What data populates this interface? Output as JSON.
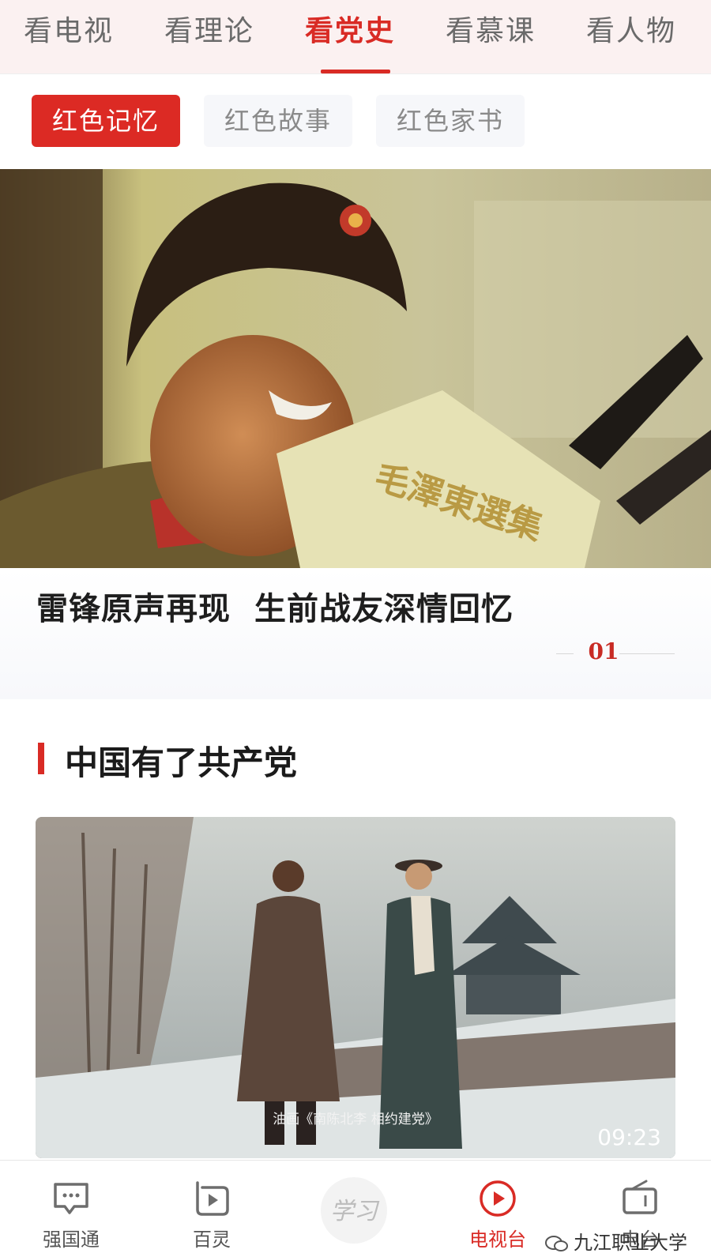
{
  "top_tabs": [
    {
      "label": "看电视",
      "active": false
    },
    {
      "label": "看理论",
      "active": false
    },
    {
      "label": "看党史",
      "active": true
    },
    {
      "label": "看慕课",
      "active": false
    },
    {
      "label": "看人物",
      "active": false
    }
  ],
  "sub_tabs": [
    {
      "label": "红色记忆",
      "active": true
    },
    {
      "label": "红色故事",
      "active": false
    },
    {
      "label": "红色家书",
      "active": false
    }
  ],
  "hero": {
    "title_part1": "雷锋原声再现",
    "title_part2": "生前战友深情回忆",
    "book_text": "毛澤東選集",
    "index": "01"
  },
  "section": {
    "title": "中国有了共产党"
  },
  "video": {
    "caption": "油画《南陈北李  相约建党》",
    "duration": "09:23"
  },
  "bottom_nav": [
    {
      "label": "强国通",
      "icon": "chat-bubble-icon",
      "active": false
    },
    {
      "label": "百灵",
      "icon": "play-tag-icon",
      "active": false
    },
    {
      "label": "学习",
      "icon": "xuexi-logo-icon",
      "active": false
    },
    {
      "label": "电视台",
      "icon": "play-circle-icon",
      "active": true
    },
    {
      "label": "电台",
      "icon": "radio-icon",
      "active": false
    }
  ],
  "watermark": "九江职业大学",
  "colors": {
    "accent": "#d92b25",
    "chip_inactive_bg": "#f6f7fa",
    "topnav_bg": "#fbf1f1"
  }
}
